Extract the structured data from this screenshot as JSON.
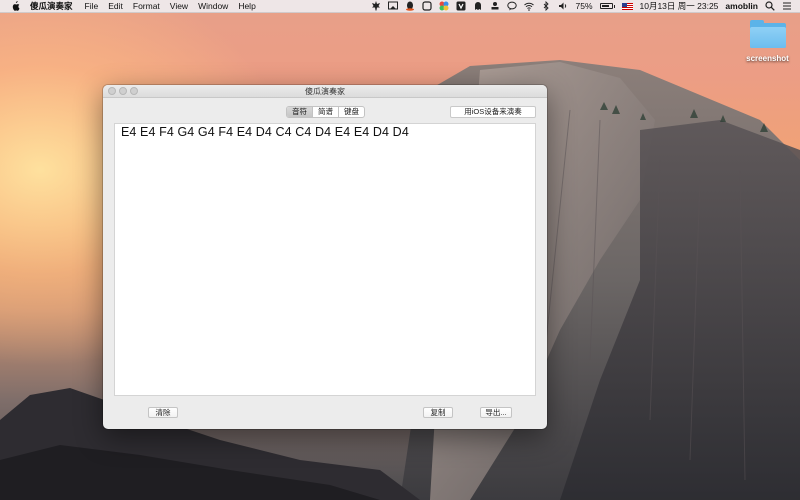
{
  "menubar": {
    "app_name": "傻瓜演奏家",
    "menus": [
      "File",
      "Edit",
      "Format",
      "View",
      "Window",
      "Help"
    ],
    "battery_text": "75%",
    "battery_level": 0.75,
    "datetime": "10月13日 周一  23:25",
    "user": "amoblin",
    "tray_icons": [
      "maple-leaf-icon",
      "screen-mirror-icon",
      "qq-icon",
      "square-icon",
      "colorful-app-icon",
      "shield-app-icon",
      "ghost-icon",
      "stamp-icon",
      "chat-bubble-icon",
      "wifi-icon",
      "bluetooth-icon",
      "volume-icon",
      "battery-icon",
      "us-flag-icon",
      "search-icon",
      "list-icon"
    ]
  },
  "desktop": {
    "icon_label": "screenshot"
  },
  "window": {
    "title": "傻瓜演奏家",
    "tabs": [
      {
        "label": "音符",
        "active": true
      },
      {
        "label": "简谱",
        "active": false
      },
      {
        "label": "键盘",
        "active": false
      }
    ],
    "ios_button": "用iOS设备来演奏",
    "notes_text": "E4 E4 F4 G4 G4 F4 E4 D4 C4 C4 D4 E4 E4 D4 D4",
    "clear_button": "清除",
    "copy_button": "复制",
    "export_button": "导出..."
  }
}
